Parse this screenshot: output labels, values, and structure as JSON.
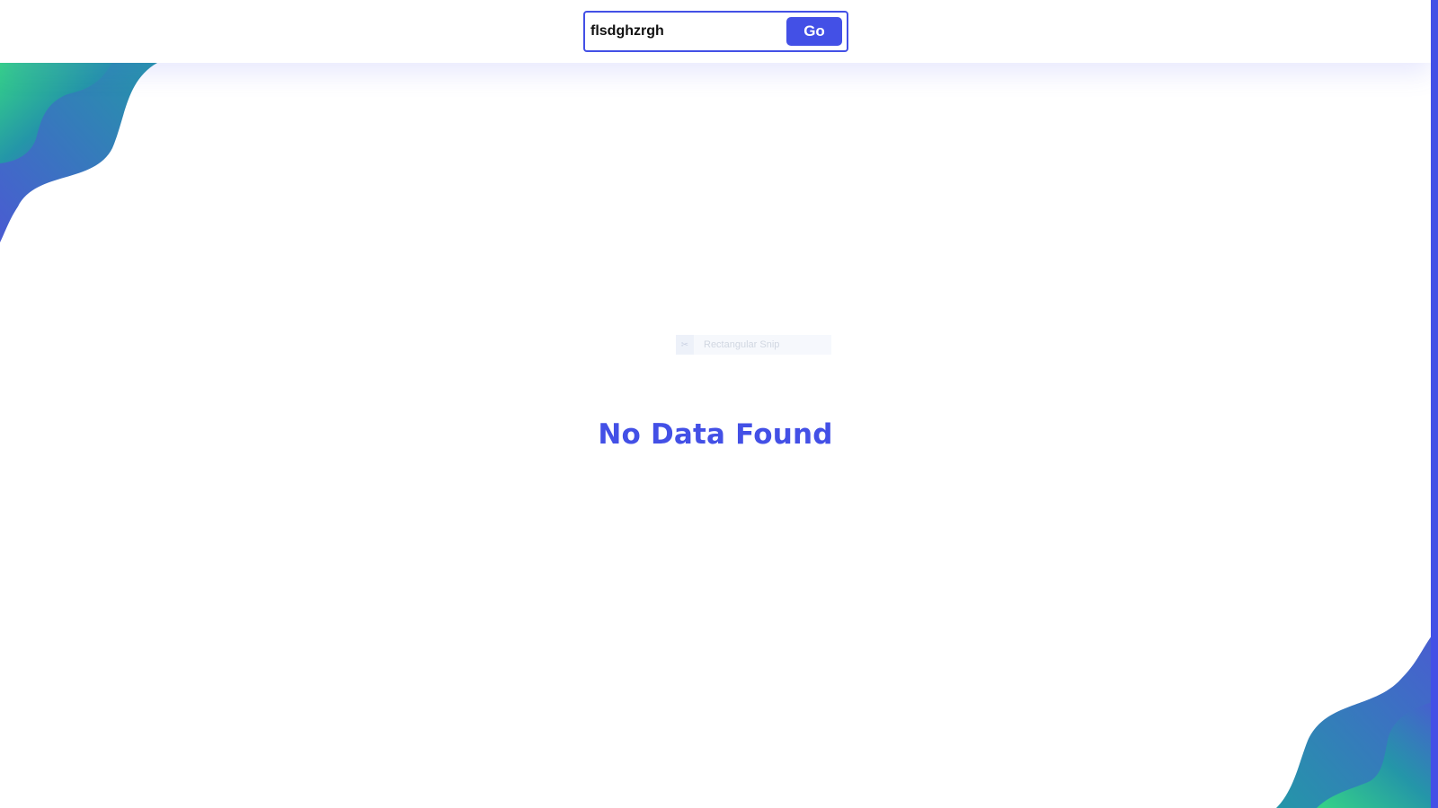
{
  "search": {
    "value": "flsdghzrgh",
    "button_label": "Go"
  },
  "snip_overlay": {
    "icon": "snip-icon",
    "label": "Rectangular Snip"
  },
  "results": {
    "empty_message": "No Data Found"
  },
  "colors": {
    "accent": "#4350e6",
    "wave_green": "#35d486",
    "wave_teal": "#2496a8",
    "wave_indigo": "#4a5bd2"
  }
}
